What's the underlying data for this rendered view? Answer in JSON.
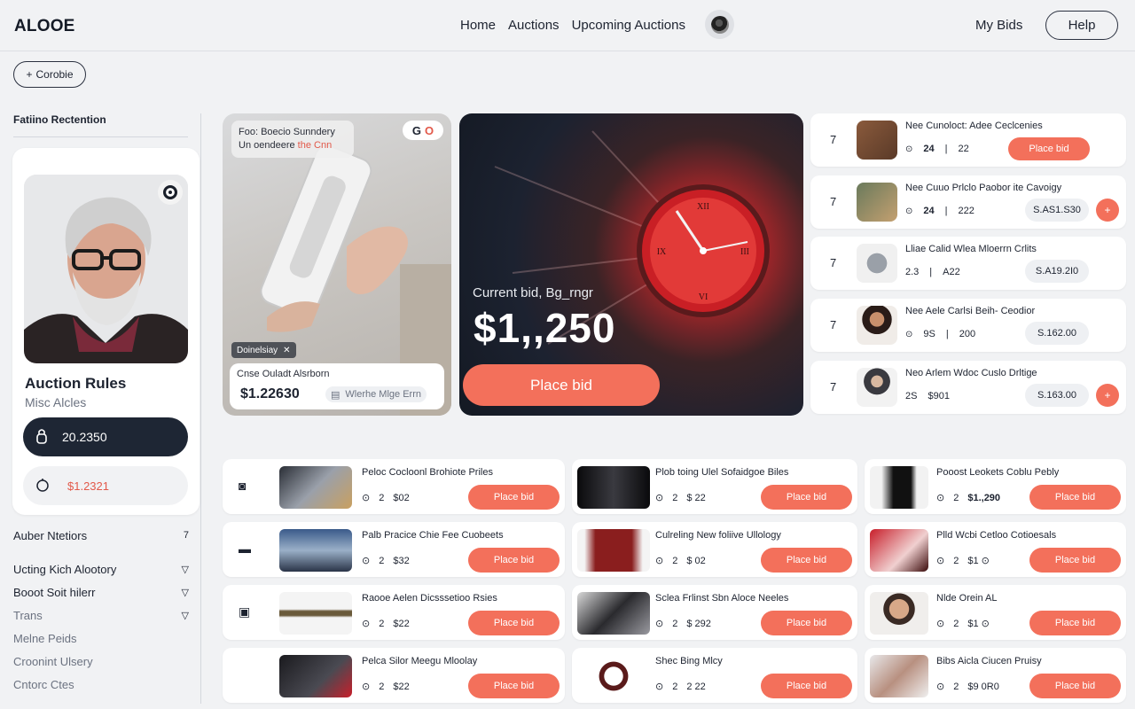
{
  "header": {
    "logo": "ALOOE",
    "nav": [
      "Home",
      "Auctions",
      "Upcoming Auctions"
    ],
    "my_bids": "My Bids",
    "help": "Help"
  },
  "sidebar": {
    "collapse_label": "Corobie",
    "section_title": "Fatiino Rectention",
    "rules_title": "Auction Rules",
    "rules_sub": "Misc Alcles",
    "dark_pill_value": "20.2350",
    "light_pill_value": "$1.2321",
    "links": [
      {
        "label": "Auber Ntetiors",
        "chevron": "7"
      },
      {
        "label": "Ucting Kich Alootory",
        "chevron": "▽"
      },
      {
        "label": "Booot Soit hilerr",
        "chevron": "▽"
      },
      {
        "label": "Trans",
        "chevron": "▽"
      },
      {
        "label": "Melne Peids",
        "chevron": ""
      },
      {
        "label": "Croonint Ulsery",
        "chevron": ""
      },
      {
        "label": "Cntorc Ctes",
        "chevron": ""
      }
    ]
  },
  "hero": {
    "card1": {
      "tag_line1": "Foo: Boecio Sunndery",
      "tag_line2_a": "Un oendeere ",
      "tag_line2_b": "the Cnn",
      "go_g": "G",
      "go_o": "O",
      "chip": "Doinelsiay",
      "bottom_title": "Cnse Ouladt Alsrborn",
      "price": "$1.22630",
      "note": "Wlerhe Mlge Errn"
    },
    "card2": {
      "label": "Current bid, Bg_rngr",
      "amount": "$1,,250",
      "cta": "Place bid"
    }
  },
  "right_list": [
    {
      "num": "7",
      "title": "Nee Cunoloct: Adee Ceclcenies",
      "a": "24",
      "b": "22",
      "button": "Place bid",
      "button_style": "red",
      "plus": false
    },
    {
      "num": "7",
      "title": "Nee Cuuo Prlclo Paobor ite Cavoigy",
      "a": "24",
      "b": "222",
      "button": "S.AS1.S30",
      "button_style": "gray",
      "plus": true
    },
    {
      "num": "7",
      "title": "Lliae Calid Wlea Mloerrn Crlits",
      "a": "2.3",
      "b": "A22",
      "button": "S.A19.2I0",
      "button_style": "gray",
      "plus": false
    },
    {
      "num": "7",
      "title": "Nee Aele Carlsi Beih- Ceodior",
      "a": "9S",
      "b": "200",
      "button": "S.162.00",
      "button_style": "gray",
      "plus": false
    },
    {
      "num": "7",
      "title": "Neo Arlem Wdoc Cuslo Drltige",
      "a": "2S",
      "b": "$901",
      "button": "S.163.00",
      "button_style": "gray",
      "plus": true
    }
  ],
  "grid": [
    {
      "title": "Peloc Cocloonl Brohiote Priles",
      "qty": "2",
      "price": "$02",
      "button": "Place bid"
    },
    {
      "title": "Plob toing Ulel Sofaidgoe Biles",
      "qty": "2",
      "price": "$ 22",
      "button": "Place bid"
    },
    {
      "title": "Pooost Leokets Coblu Pebly",
      "qty": "2",
      "price": "$1.,290",
      "button": "Place bid"
    },
    {
      "title": "Palb Pracice Chie Fee Cuobeets",
      "qty": "2",
      "price": "$32",
      "button": "Place bid"
    },
    {
      "title": "Culreling New foliive Ullology",
      "qty": "2",
      "price": "$ 02",
      "button": "Place bid"
    },
    {
      "title": "Plld Wcbi Cetloo Cotioesals",
      "qty": "2",
      "price": "$1 ⊙",
      "button": "Place bid"
    },
    {
      "title": "Raooe Aelen Dicsssetioo Rsies",
      "qty": "2",
      "price": "$22",
      "button": "Place bid"
    },
    {
      "title": "Sclea Frlinst Sbn Aloce Neeles",
      "qty": "2",
      "price": "$ 292",
      "button": "Place bid"
    },
    {
      "title": "Nlde Orein AL",
      "qty": "2",
      "price": "$1 ⊙",
      "button": "Place bid"
    },
    {
      "title": "Pelca Silor Meegu Mloolay",
      "qty": "2",
      "price": "$22",
      "button": "Place bid"
    },
    {
      "title": "Shec Bing Mlcy",
      "qty": "2",
      "price": "2 22",
      "button": "Place bid"
    },
    {
      "title": "Bibs Aicla Ciucen Pruisy",
      "qty": "2",
      "price": "$9 0R0",
      "button": "Place bid"
    }
  ],
  "colors": {
    "accent": "#f3705b",
    "dark": "#1e2634",
    "background": "#f1f2f4"
  }
}
